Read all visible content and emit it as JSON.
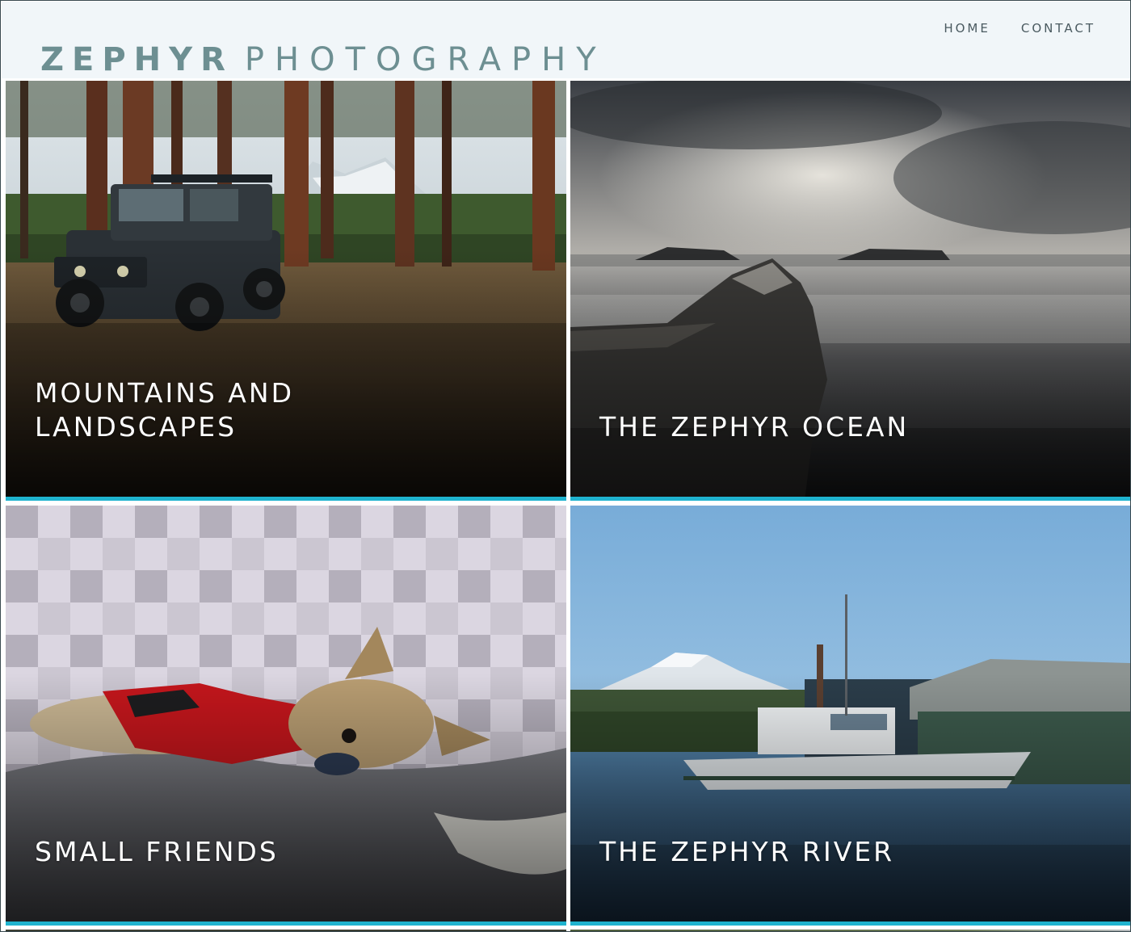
{
  "site": {
    "brand_strong": "ZEPHYR",
    "brand_light": "PHOTOGRAPHY"
  },
  "nav": {
    "items": [
      {
        "label": "HOME"
      },
      {
        "label": "CONTACT"
      }
    ]
  },
  "gallery": {
    "tiles": [
      {
        "title": "MOUNTAINS AND LANDSCAPES",
        "photo": "jeep-in-forest"
      },
      {
        "title": "THE ZEPHYR OCEAN",
        "photo": "driftwood-on-beach"
      },
      {
        "title": "SMALL FRIENDS",
        "photo": "yorkie-sleeping"
      },
      {
        "title": "THE ZEPHYR RIVER",
        "photo": "boat-on-river"
      }
    ]
  },
  "colors": {
    "header_bg": "#f1f6f9",
    "brand": "#6d8f92",
    "nav_text": "#4a5a60",
    "accent": "#1fb3cf"
  }
}
